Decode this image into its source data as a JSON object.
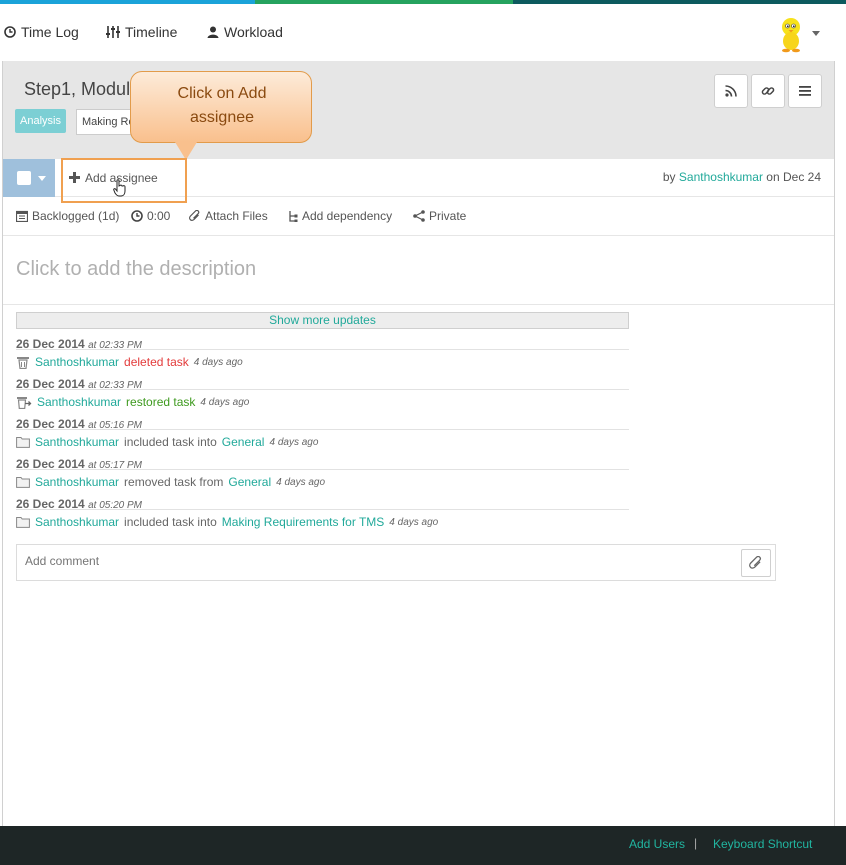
{
  "nav": {
    "time_log": "Time Log",
    "timeline": "Timeline",
    "workload": "Workload"
  },
  "task": {
    "title": "Step1, Module",
    "status_tag": "Analysis",
    "project_tag": "Making Requirements for TMS"
  },
  "callout": {
    "text": "Click on Add\nassignee"
  },
  "toolbar": {
    "add_assignee": "Add assignee",
    "by": "by",
    "author": "Santhoshkumar",
    "on": "on Dec 24"
  },
  "meta": {
    "status": "Backlogged (1d)",
    "time": "0:00",
    "attach": "Attach Files",
    "dependency": "Add dependency",
    "privacy": "Private"
  },
  "description_placeholder": "Click to add the description",
  "show_more": "Show more updates",
  "log": [
    {
      "date": "26 Dec 2014",
      "time": "at 02:33 PM",
      "icon": "trash-icon",
      "user": "Santhoshkumar",
      "action": "deleted task",
      "action_color": "red",
      "target": "",
      "ago": "4 days ago"
    },
    {
      "date": "26 Dec 2014",
      "time": "at 02:33 PM",
      "icon": "restore-icon",
      "user": "Santhoshkumar",
      "action": "restored task",
      "action_color": "green",
      "target": "",
      "ago": "4 days ago"
    },
    {
      "date": "26 Dec 2014",
      "time": "at 05:16 PM",
      "icon": "folder-icon",
      "user": "Santhoshkumar",
      "action": "included task into",
      "action_color": "plain",
      "target": "General",
      "ago": "4 days ago"
    },
    {
      "date": "26 Dec 2014",
      "time": "at 05:17 PM",
      "icon": "folder-icon",
      "user": "Santhoshkumar",
      "action": "removed task from",
      "action_color": "plain",
      "target": "General",
      "ago": "4 days ago"
    },
    {
      "date": "26 Dec 2014",
      "time": "at 05:20 PM",
      "icon": "folder-icon",
      "user": "Santhoshkumar",
      "action": "included task into",
      "action_color": "plain",
      "target": "Making Requirements for TMS",
      "ago": "4 days ago"
    }
  ],
  "comment": {
    "placeholder": "Add comment"
  },
  "footer": {
    "add_users": "Add Users",
    "separator": "|",
    "shortcuts": "Keyboard Shortcut"
  },
  "colors": {
    "accent": "#21a99a",
    "callout_border": "#e29b4a",
    "footer_bg": "#1e2626"
  }
}
